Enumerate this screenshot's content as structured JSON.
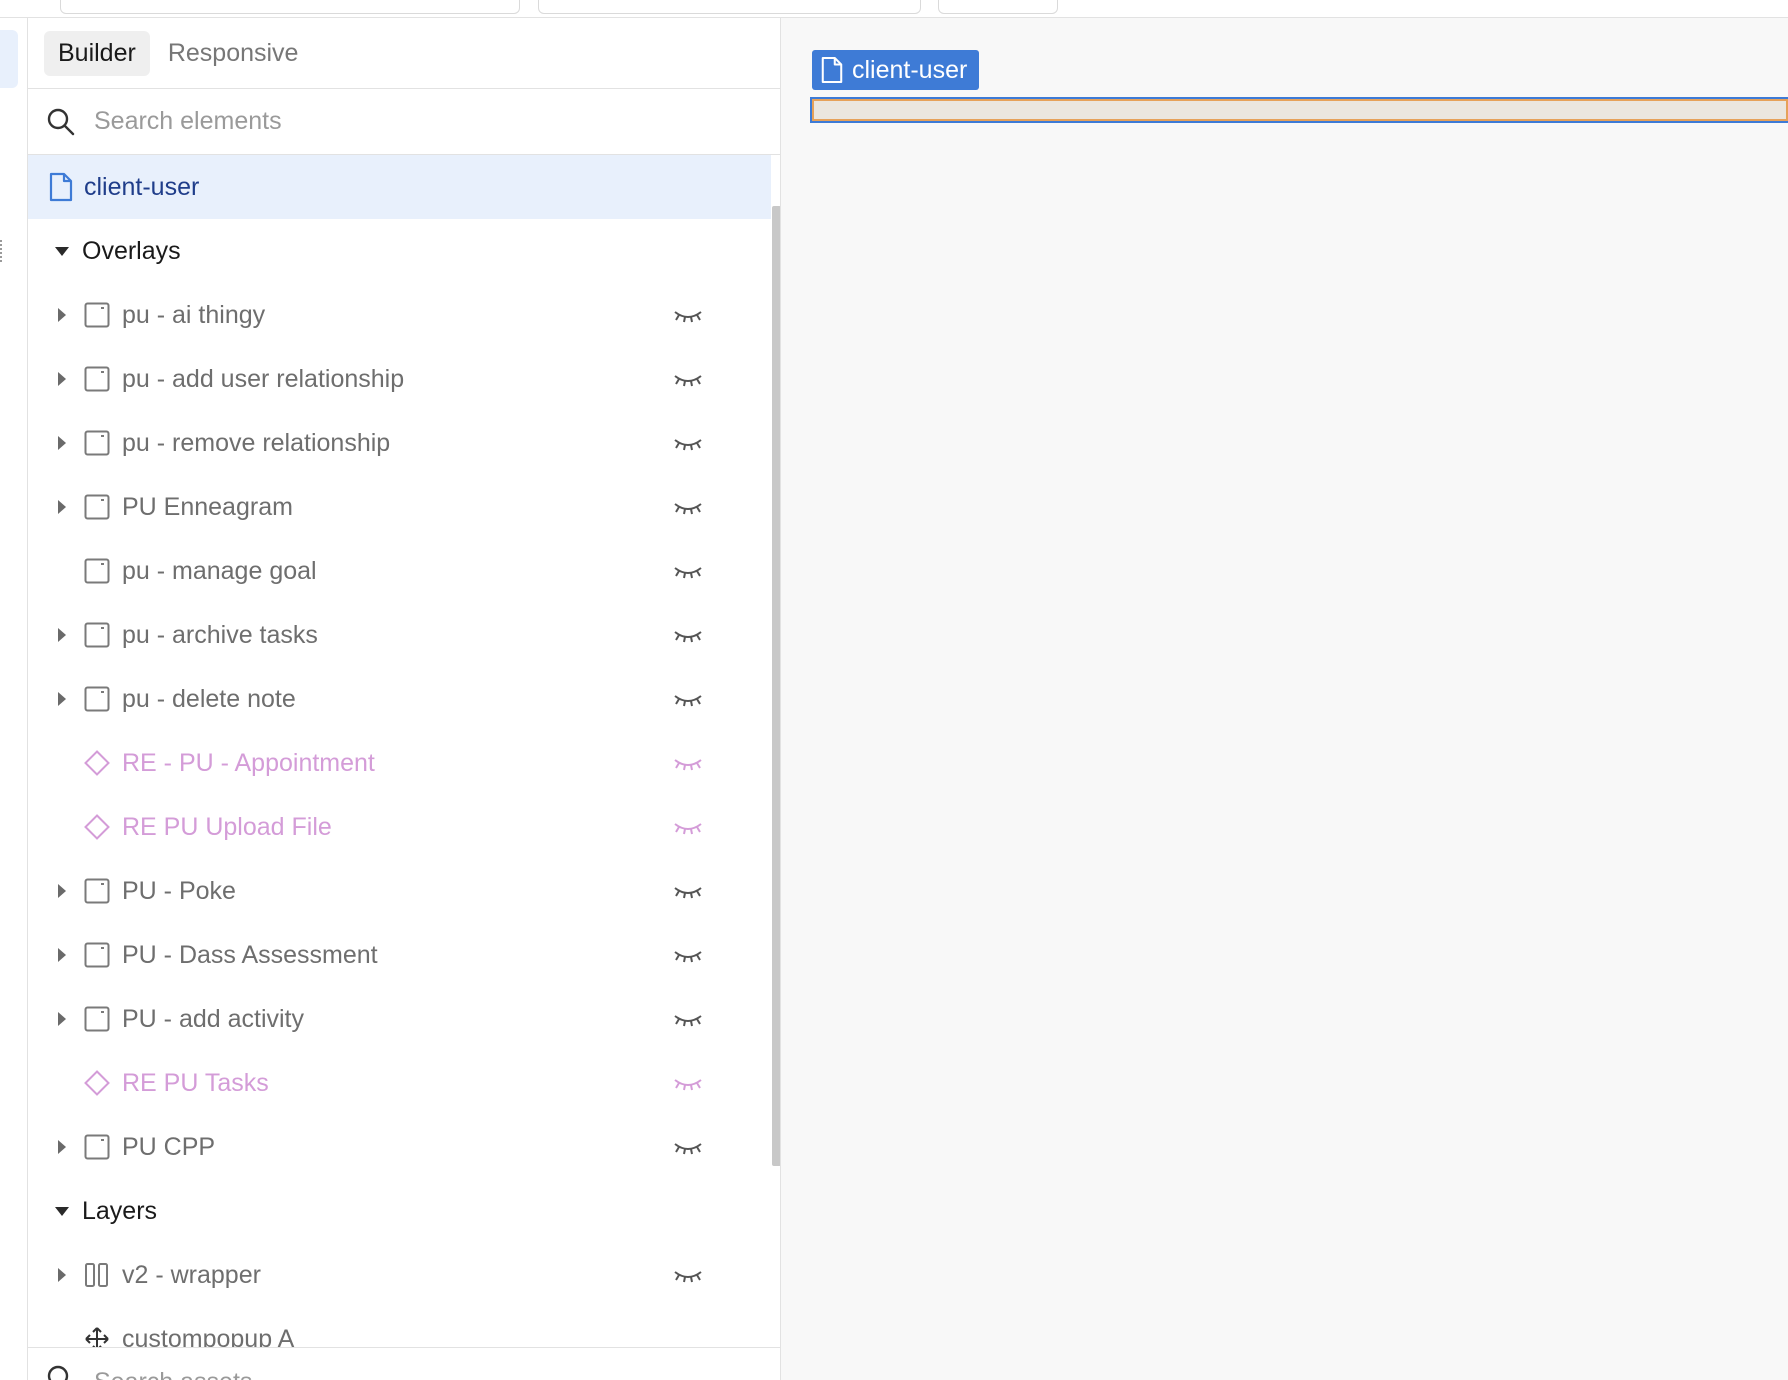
{
  "tabs": {
    "builder": "Builder",
    "responsive": "Responsive"
  },
  "search": {
    "placeholder": "Search elements"
  },
  "page": {
    "name": "client-user"
  },
  "sections": {
    "overlays": "Overlays",
    "layers": "Layers"
  },
  "overlays": [
    {
      "label": "pu - ai thingy",
      "type": "popup",
      "expandable": true
    },
    {
      "label": "pu - add user relationship",
      "type": "popup",
      "expandable": true
    },
    {
      "label": "pu - remove relationship",
      "type": "popup",
      "expandable": true
    },
    {
      "label": "PU Enneagram",
      "type": "popup",
      "expandable": true
    },
    {
      "label": "pu - manage goal",
      "type": "popup",
      "expandable": false
    },
    {
      "label": "pu - archive tasks",
      "type": "popup",
      "expandable": true
    },
    {
      "label": "pu - delete note",
      "type": "popup",
      "expandable": true
    },
    {
      "label": "RE - PU - Appointment",
      "type": "reusable",
      "expandable": false
    },
    {
      "label": "RE PU Upload File",
      "type": "reusable",
      "expandable": false
    },
    {
      "label": "PU - Poke",
      "type": "popup",
      "expandable": true
    },
    {
      "label": "PU - Dass Assessment",
      "type": "popup",
      "expandable": true
    },
    {
      "label": "PU - add activity",
      "type": "popup",
      "expandable": true
    },
    {
      "label": "RE PU Tasks",
      "type": "reusable",
      "expandable": false
    },
    {
      "label": "PU CPP",
      "type": "popup",
      "expandable": true
    }
  ],
  "layers": [
    {
      "label": "v2 - wrapper",
      "type": "group",
      "expandable": true
    },
    {
      "label": "custompopup A",
      "type": "floating",
      "expandable": false
    }
  ],
  "bottom_search": {
    "placeholder": "Search assets"
  },
  "canvas": {
    "page_label": "client-user"
  },
  "colors": {
    "accent": "#3e7bd6",
    "reusable": "#d49cd8",
    "selected_bg": "#e8f0fc"
  },
  "icons": {
    "search": "search-icon",
    "page": "page-icon",
    "popup": "popup-icon",
    "reusable": "reusable-diamond-icon",
    "group": "group-icon",
    "floating": "move-icon",
    "hidden": "eye-closed-icon"
  }
}
